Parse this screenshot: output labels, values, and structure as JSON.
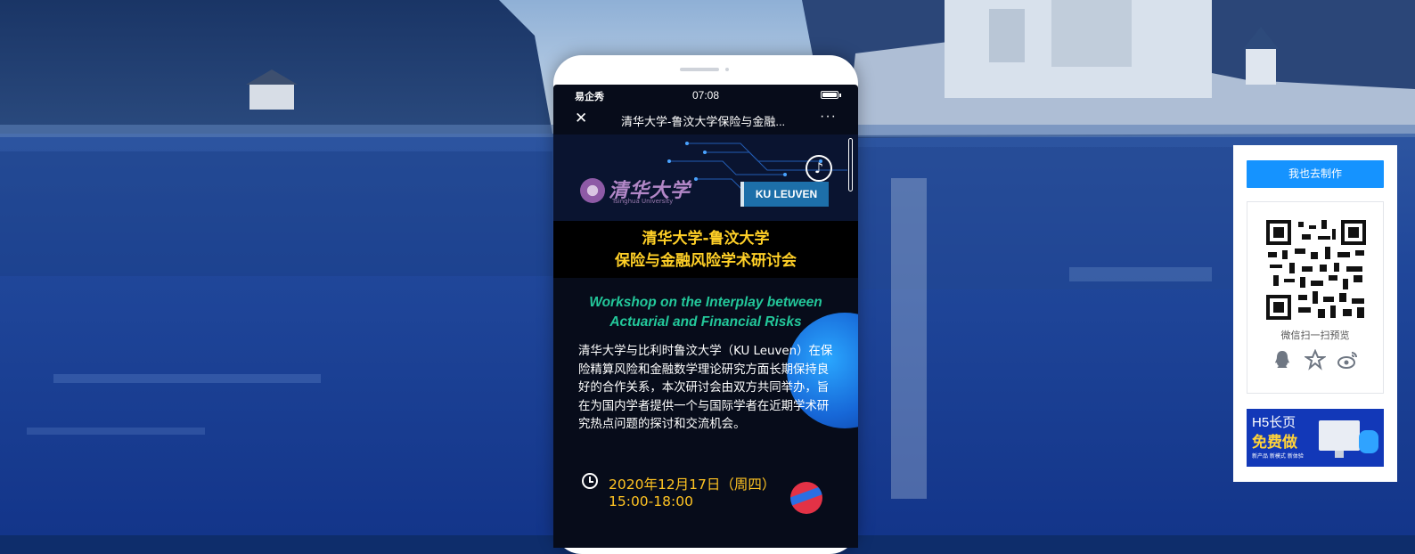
{
  "phone": {
    "status_bar": {
      "carrier": "易企秀",
      "time": "07:08"
    },
    "nav": {
      "close_icon": "close-icon",
      "title": "清华大学-鲁汶大学保险与金融...",
      "more_label": "···"
    },
    "page": {
      "music_icon": "music-note-icon",
      "tsinghua_logo_text": "清华大学",
      "tsinghua_logo_en": "Tsinghua University",
      "ku_logo_text": "KU LEUVEN",
      "title_line1": "清华大学-鲁汶大学",
      "title_line2": "保险与金融风险学术研讨会",
      "workshop_line1": "Workshop on the Interplay between",
      "workshop_line2": "Actuarial and Financial Risks",
      "description": "清华大学与比利时鲁汶大学（KU Leuven）在保险精算风险和金融数学理论研究方面长期保持良好的合作关系，本次研讨会由双方共同举办，旨在为国内学者提供一个与国际学者在近期学术研究热点问题的探讨和交流机会。",
      "date_line1": "2020年12月17日（周四）",
      "date_line2": "15:00-18:00",
      "clock_icon": "clock-icon"
    }
  },
  "panel": {
    "make_button": "我也去制作",
    "qr_caption": "微信扫一扫预览",
    "share_icons": [
      "qq-icon",
      "qzone-star-icon",
      "weibo-icon"
    ],
    "promo": {
      "line1": "H5长页",
      "line2": "免费做",
      "line3": "新产品 新模式 新体验"
    }
  },
  "colors": {
    "accent": "#1593ff",
    "title_yellow": "#ffd027",
    "workshop_green": "#23c79a",
    "date_orange": "#ffc322"
  }
}
